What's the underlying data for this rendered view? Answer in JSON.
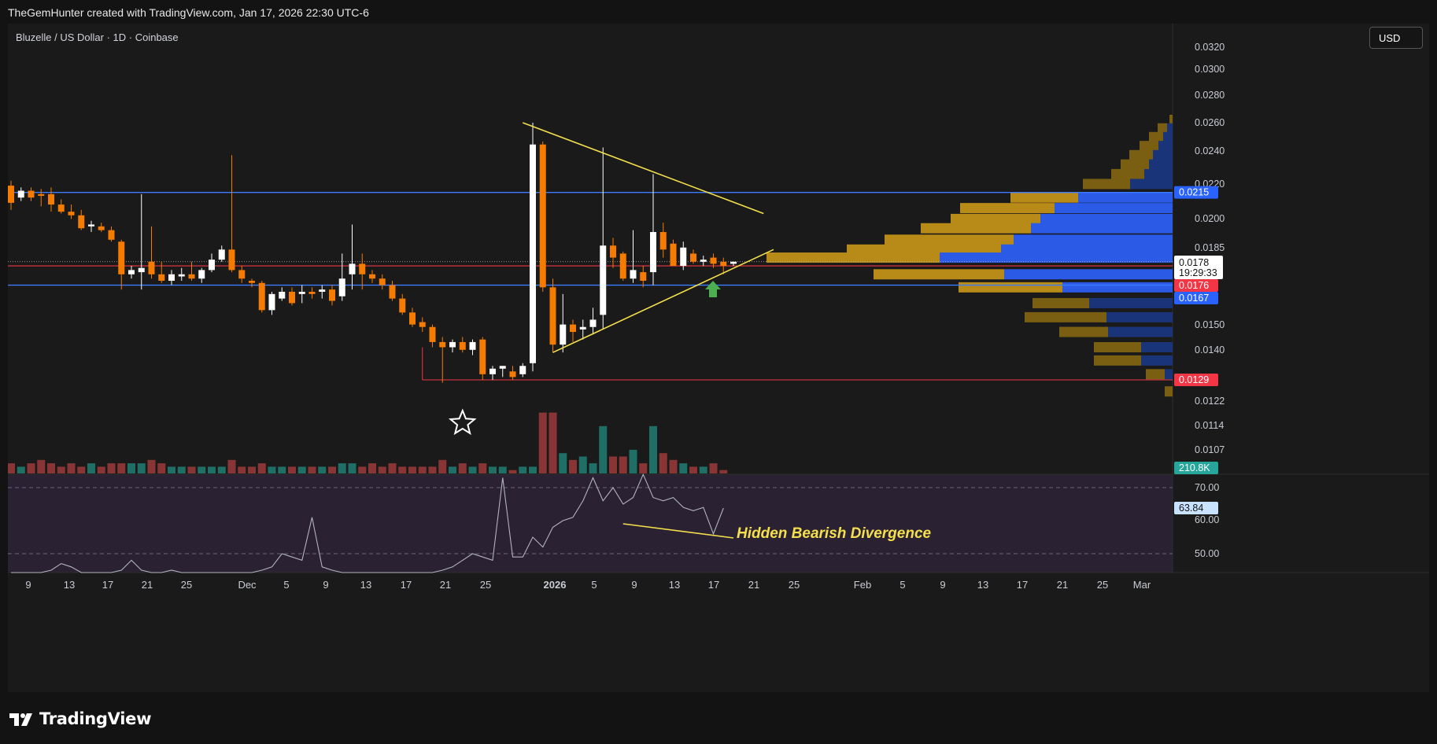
{
  "header": {
    "caption": "TheGemHunter created with TradingView.com, Jan 17, 2026 22:30 UTC-6"
  },
  "symbol": {
    "title": "Bluzelle / US Dollar · 1D · Coinbase"
  },
  "currency_button": "USD",
  "footer": {
    "brand": "TradingView"
  },
  "colors": {
    "up": "#ffffff",
    "down": "#f57c00",
    "vol_up": "#1f6f67",
    "vol_down": "#8a3535",
    "support_line": "#3d7bff",
    "red_line": "#f23645",
    "triangle": "#f4e04d",
    "rsi_line": "#b2b5be",
    "rsi_bg": "#2a2133",
    "annotation": "#f4e04d",
    "vp_up": "#7a5f12",
    "vp_down": "#1a347a",
    "vp_up_bright": "#b88a18",
    "vp_down_bright": "#2b5ae6"
  },
  "chart_data": {
    "type": "candlestick",
    "price_axis": {
      "ticks": [
        "0.0320",
        "0.0300",
        "0.0280",
        "0.0260",
        "0.0240",
        "0.0220",
        "0.0200",
        "0.0185",
        "0.0150",
        "0.0140",
        "0.0122",
        "0.0114",
        "0.0107"
      ],
      "log_scale": true
    },
    "price_labels": {
      "resistance": "0.0215",
      "last_price": "0.0178",
      "countdown": "19:29:33",
      "red_level": "0.0176",
      "support": "0.0167",
      "low_line": "0.0129",
      "volume_last": "210.8K"
    },
    "rsi": {
      "ticks": [
        "70.00",
        "60.00",
        "50.00"
      ],
      "current": "63.84",
      "values": [
        41,
        42,
        43,
        44,
        45,
        47,
        46,
        44,
        42,
        43,
        44,
        45,
        48,
        45,
        43,
        44,
        45,
        42,
        41,
        42,
        43,
        44,
        42,
        43,
        44,
        45,
        46,
        50,
        49,
        48,
        61,
        46,
        45,
        44,
        43,
        42,
        41,
        42,
        43,
        44,
        43,
        42,
        44,
        45,
        46,
        48,
        50,
        49,
        48,
        73,
        49,
        49,
        55,
        52,
        58,
        60,
        61,
        66,
        73,
        66,
        70,
        65,
        67,
        74,
        67,
        66,
        67,
        64,
        63,
        64,
        56,
        63.8
      ]
    },
    "time_axis": [
      "9",
      "13",
      "17",
      "21",
      "25",
      "Dec",
      "5",
      "9",
      "13",
      "17",
      "21",
      "25",
      "2026",
      "5",
      "9",
      "13",
      "17",
      "21",
      "25",
      "Feb",
      "5",
      "9",
      "13",
      "17",
      "21",
      "25",
      "Mar"
    ],
    "ohlc": [
      [
        0.0219,
        0.0222,
        0.0205,
        0.0209
      ],
      [
        0.0212,
        0.0218,
        0.021,
        0.0216
      ],
      [
        0.0216,
        0.0218,
        0.021,
        0.0212
      ],
      [
        0.0214,
        0.0217,
        0.0207,
        0.0213
      ],
      [
        0.0214,
        0.0218,
        0.0204,
        0.0208
      ],
      [
        0.0208,
        0.0211,
        0.0203,
        0.0204
      ],
      [
        0.0204,
        0.0208,
        0.02,
        0.0202
      ],
      [
        0.0202,
        0.0205,
        0.0194,
        0.0195
      ],
      [
        0.0196,
        0.0199,
        0.0193,
        0.0197
      ],
      [
        0.0196,
        0.0198,
        0.0193,
        0.0194
      ],
      [
        0.0194,
        0.0196,
        0.0188,
        0.0189
      ],
      [
        0.0188,
        0.0189,
        0.0165,
        0.0172
      ],
      [
        0.0172,
        0.0176,
        0.017,
        0.0174
      ],
      [
        0.0173,
        0.0214,
        0.0165,
        0.0175
      ],
      [
        0.0178,
        0.0196,
        0.017,
        0.0172
      ],
      [
        0.0172,
        0.0178,
        0.0168,
        0.0169
      ],
      [
        0.0169,
        0.0174,
        0.0167,
        0.0172
      ],
      [
        0.0171,
        0.0175,
        0.0169,
        0.0172
      ],
      [
        0.0172,
        0.0178,
        0.0169,
        0.017
      ],
      [
        0.017,
        0.0175,
        0.0168,
        0.0174
      ],
      [
        0.0174,
        0.0182,
        0.0173,
        0.0179
      ],
      [
        0.0179,
        0.0186,
        0.0178,
        0.0184
      ],
      [
        0.0184,
        0.0238,
        0.0173,
        0.0174
      ],
      [
        0.0174,
        0.0176,
        0.0168,
        0.017
      ],
      [
        0.0169,
        0.017,
        0.0166,
        0.0168
      ],
      [
        0.0168,
        0.0169,
        0.0155,
        0.0156
      ],
      [
        0.0156,
        0.0164,
        0.0154,
        0.0163
      ],
      [
        0.0161,
        0.0166,
        0.016,
        0.0164
      ],
      [
        0.0164,
        0.0166,
        0.0158,
        0.0159
      ],
      [
        0.0163,
        0.0167,
        0.0159,
        0.0164
      ],
      [
        0.0164,
        0.0166,
        0.0161,
        0.0163
      ],
      [
        0.0164,
        0.0167,
        0.0161,
        0.0165
      ],
      [
        0.0165,
        0.0167,
        0.0158,
        0.016
      ],
      [
        0.0162,
        0.0182,
        0.016,
        0.017
      ],
      [
        0.0172,
        0.0197,
        0.0165,
        0.0177
      ],
      [
        0.0177,
        0.0182,
        0.0165,
        0.0172
      ],
      [
        0.0172,
        0.0174,
        0.0168,
        0.017
      ],
      [
        0.017,
        0.0172,
        0.0165,
        0.0167
      ],
      [
        0.0167,
        0.0169,
        0.016,
        0.0161
      ],
      [
        0.0161,
        0.0163,
        0.0154,
        0.0155
      ],
      [
        0.0155,
        0.0157,
        0.0149,
        0.015
      ],
      [
        0.0151,
        0.0153,
        0.0147,
        0.0149
      ],
      [
        0.0149,
        0.015,
        0.0141,
        0.0143
      ],
      [
        0.0143,
        0.0145,
        0.0128,
        0.0141
      ],
      [
        0.0141,
        0.0144,
        0.0139,
        0.0143
      ],
      [
        0.0143,
        0.0145,
        0.0139,
        0.014
      ],
      [
        0.014,
        0.0144,
        0.0138,
        0.0143
      ],
      [
        0.0144,
        0.0145,
        0.0129,
        0.0131
      ],
      [
        0.0131,
        0.0134,
        0.0129,
        0.0133
      ],
      [
        0.0133,
        0.0134,
        0.013,
        0.0134
      ],
      [
        0.0132,
        0.0134,
        0.0129,
        0.013
      ],
      [
        0.0131,
        0.0135,
        0.013,
        0.0134
      ],
      [
        0.0135,
        0.026,
        0.0132,
        0.0245
      ],
      [
        0.0245,
        0.0247,
        0.0164,
        0.0166
      ],
      [
        0.0166,
        0.017,
        0.0139,
        0.0142
      ],
      [
        0.0142,
        0.0163,
        0.0139,
        0.015
      ],
      [
        0.015,
        0.0152,
        0.0143,
        0.0147
      ],
      [
        0.0148,
        0.0152,
        0.0144,
        0.0149
      ],
      [
        0.0149,
        0.0157,
        0.0146,
        0.0152
      ],
      [
        0.0154,
        0.0243,
        0.0148,
        0.0186
      ],
      [
        0.0186,
        0.019,
        0.0175,
        0.018
      ],
      [
        0.0182,
        0.0183,
        0.0169,
        0.017
      ],
      [
        0.017,
        0.0194,
        0.0168,
        0.0174
      ],
      [
        0.0173,
        0.0176,
        0.0166,
        0.0169
      ],
      [
        0.0173,
        0.0226,
        0.0167,
        0.0193
      ],
      [
        0.0193,
        0.0198,
        0.018,
        0.0184
      ],
      [
        0.0187,
        0.0189,
        0.0176,
        0.0176
      ],
      [
        0.0176,
        0.0188,
        0.0174,
        0.0185
      ],
      [
        0.0182,
        0.0184,
        0.0177,
        0.0178
      ],
      [
        0.0178,
        0.0181,
        0.0176,
        0.0179
      ],
      [
        0.018,
        0.0182,
        0.0175,
        0.0177
      ],
      [
        0.0178,
        0.018,
        0.0172,
        0.0176
      ],
      [
        0.0177,
        0.0178,
        0.0176,
        0.0178
      ]
    ],
    "volume": [
      3,
      2,
      3,
      4,
      3,
      2,
      3,
      2,
      3,
      2,
      3,
      3,
      3,
      3,
      4,
      3,
      2,
      2,
      2,
      2,
      2,
      2,
      4,
      2,
      2,
      3,
      2,
      2,
      2,
      2,
      2,
      2,
      2,
      3,
      3,
      2,
      3,
      2,
      3,
      2,
      2,
      2,
      2,
      4,
      2,
      3,
      2,
      3,
      2,
      2,
      1,
      2,
      2,
      18,
      18,
      6,
      4,
      5,
      3,
      14,
      5,
      5,
      7,
      3,
      14,
      6,
      4,
      3,
      2,
      2,
      3,
      1
    ],
    "volume_profile": [
      {
        "p": 0.0262,
        "up": 4,
        "down": 0
      },
      {
        "p": 0.0256,
        "up": 12,
        "down": 7
      },
      {
        "p": 0.025,
        "up": 18,
        "down": 12
      },
      {
        "p": 0.0244,
        "up": 24,
        "down": 18
      },
      {
        "p": 0.0238,
        "up": 30,
        "down": 25
      },
      {
        "p": 0.0232,
        "up": 36,
        "down": 30
      },
      {
        "p": 0.0226,
        "up": 42,
        "down": 36
      },
      {
        "p": 0.022,
        "up": 60,
        "down": 54
      },
      {
        "p": 0.0212,
        "up": 86,
        "down": 120
      },
      {
        "p": 0.0206,
        "up": 120,
        "down": 150
      },
      {
        "p": 0.02,
        "up": 114,
        "down": 168
      },
      {
        "p": 0.0195,
        "up": 140,
        "down": 180
      },
      {
        "p": 0.0189,
        "up": 164,
        "down": 202
      },
      {
        "p": 0.0184,
        "up": 196,
        "down": 218
      },
      {
        "p": 0.018,
        "up": 220,
        "down": 296
      },
      {
        "p": 0.0172,
        "up": 166,
        "down": 214
      },
      {
        "p": 0.0166,
        "up": 132,
        "down": 140
      },
      {
        "p": 0.0159,
        "up": 72,
        "down": 106
      },
      {
        "p": 0.0153,
        "up": 104,
        "down": 84
      },
      {
        "p": 0.0147,
        "up": 62,
        "down": 82
      },
      {
        "p": 0.0141,
        "up": 60,
        "down": 40
      },
      {
        "p": 0.0136,
        "up": 60,
        "down": 40
      },
      {
        "p": 0.0131,
        "up": 24,
        "down": 10
      },
      {
        "p": 0.0125,
        "up": 10,
        "down": 0
      }
    ],
    "annotations": {
      "divergence_label": "Hidden Bearish Divergence"
    }
  }
}
